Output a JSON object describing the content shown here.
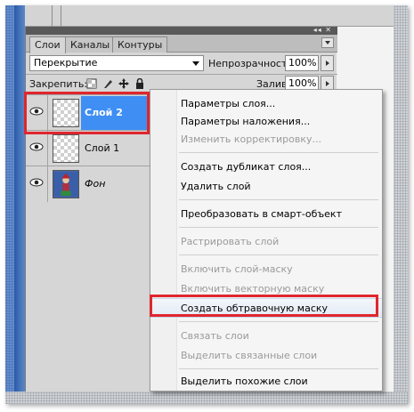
{
  "panel": {
    "tabs": [
      {
        "label": "Слои",
        "active": true
      },
      {
        "label": "Каналы",
        "active": false
      },
      {
        "label": "Контуры",
        "active": false
      }
    ],
    "titlebar_icons": "◂◂ ✕",
    "blend_mode": "Перекрытие",
    "opacity_label": "Непрозрачность:",
    "opacity_value": "100%",
    "lock_label": "Закрепить:",
    "fill_label": "Заливка:",
    "fill_value": "100%"
  },
  "layers": [
    {
      "name": "Слой 2",
      "selected": true,
      "visible": true,
      "thumb": "transparent"
    },
    {
      "name": "Слой 1",
      "selected": false,
      "visible": true,
      "thumb": "transparent"
    },
    {
      "name": "Фон",
      "selected": false,
      "visible": true,
      "thumb": "image",
      "italic": true
    }
  ],
  "context_menu": {
    "items": [
      {
        "label": "Параметры слоя...",
        "enabled": true
      },
      {
        "label": "Параметры наложения...",
        "enabled": true
      },
      {
        "label": "Изменить корректировку...",
        "enabled": false
      },
      {
        "label": "Создать дубликат слоя...",
        "enabled": true
      },
      {
        "label": "Удалить слой",
        "enabled": true
      },
      {
        "label": "Преобразовать в смарт-объект",
        "enabled": true
      },
      {
        "label": "Растрировать слой",
        "enabled": false
      },
      {
        "label": "Включить слой-маску",
        "enabled": false
      },
      {
        "label": "Включить векторную маску",
        "enabled": false
      },
      {
        "label": "Создать обтравочную маску",
        "enabled": true,
        "highlighted": true
      },
      {
        "label": "Связать слои",
        "enabled": false
      },
      {
        "label": "Выделить связанные слои",
        "enabled": false
      },
      {
        "label": "Выделить похожие слои",
        "enabled": true
      }
    ]
  },
  "colors": {
    "selection_blue": "#3e8ef4",
    "annotation_red": "#e0262e",
    "panel_gray": "#d6d6d6"
  }
}
